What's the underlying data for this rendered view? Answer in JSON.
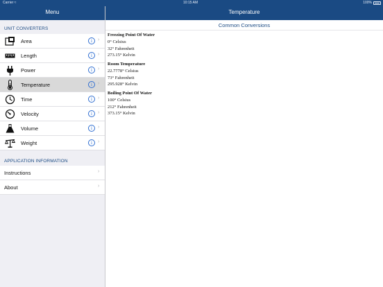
{
  "status_bar": {
    "carrier": "Carrier ≈",
    "time": "10:15 AM",
    "battery": "100%"
  },
  "sidebar": {
    "title": "Menu",
    "unit_header": "UNIT CONVERTERS",
    "items": [
      {
        "label": "Area",
        "icon": "area-icon"
      },
      {
        "label": "Length",
        "icon": "ruler-icon"
      },
      {
        "label": "Power",
        "icon": "plug-icon"
      },
      {
        "label": "Temperature",
        "icon": "thermometer-icon",
        "selected": true
      },
      {
        "label": "Time",
        "icon": "clock-icon"
      },
      {
        "label": "Velocity",
        "icon": "speedometer-icon"
      },
      {
        "label": "Volume",
        "icon": "flask-icon"
      },
      {
        "label": "Weight",
        "icon": "scale-icon"
      }
    ],
    "info_glyph": "i",
    "chevron_glyph": "›",
    "app_header": "APPLICATION INFORMATION",
    "app_items": [
      {
        "label": "Instructions"
      },
      {
        "label": "About"
      }
    ]
  },
  "main": {
    "title": "Temperature",
    "subtitle": "Common Conversions",
    "blocks": [
      {
        "heading": "Freezing Point Of Water",
        "lines": [
          "0° Celsius",
          "32° Fahrenheit",
          "273.15° Kelvin"
        ]
      },
      {
        "heading": "Room Temperature",
        "lines": [
          "22.7778° Celsius",
          "73° Fahrenheit",
          "295.928° Kelvin"
        ]
      },
      {
        "heading": "Boiling Point Of Water",
        "lines": [
          "100° Celsius",
          "212° Fahrenheit",
          "373.15° Kelvin"
        ]
      }
    ]
  },
  "colors": {
    "nav_bar": "#1a4a83",
    "section_header": "#1a4a83",
    "info_icon": "#2f6ed1",
    "selected_row": "#d9d9d9"
  }
}
